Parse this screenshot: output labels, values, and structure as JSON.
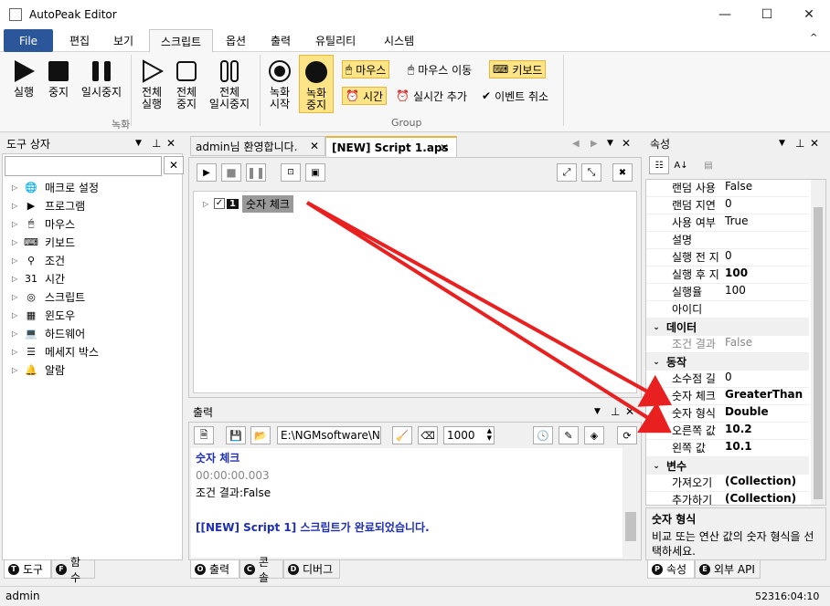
{
  "app": {
    "title": "AutoPeak Editor"
  },
  "window_controls": {
    "minimize": "—",
    "maximize": "☐",
    "close": "✕"
  },
  "menu": {
    "file": "File",
    "edit": "편집",
    "view": "보기",
    "script": "스크립트",
    "options": "옵션",
    "output": "출력",
    "utility": "유틸리티",
    "system": "시스템",
    "collapse": "^"
  },
  "ribbon": {
    "run": "실행",
    "stop": "중지",
    "pause": "일시중지",
    "run_all": [
      "전체",
      "실행"
    ],
    "stop_all": [
      "전체",
      "중지"
    ],
    "pause_all": [
      "전체",
      "일시중지"
    ],
    "rec_start": [
      "녹화",
      "시작"
    ],
    "rec_stop": [
      "녹화",
      "중지"
    ],
    "mouse": "마우스",
    "mouse_move": "마우스 이동",
    "keyboard": "키보드",
    "time": "시간",
    "realtime_add": "실시간 추가",
    "event_cancel": "이벤트 취소",
    "group_record": "녹화",
    "group_group": "Group"
  },
  "toolbox": {
    "title": "도구 상자",
    "clear": "✕",
    "items": [
      "매크로 설정",
      "프로그램",
      "마우스",
      "키보드",
      "조건",
      "시간",
      "스크립트",
      "윈도우",
      "하드웨어",
      "메세지 박스",
      "알람"
    ],
    "tab_tools": "도구",
    "tab_functions": "함수"
  },
  "doc_tabs": {
    "tab1": "admin님 환영합니다.",
    "tab2": "[NEW] Script 1.aps"
  },
  "script_tree": {
    "num": "1",
    "label": "숫자 체크"
  },
  "output": {
    "title": "출력",
    "path": "E:\\NGMsoftware\\NG",
    "count": "1000",
    "lines": [
      {
        "text": "숫자 체크",
        "cls": "blue b"
      },
      {
        "text": "00:00:00.003",
        "cls": "gray"
      },
      {
        "text": "조건 결과:False",
        "cls": ""
      },
      {
        "text": "",
        "cls": ""
      },
      {
        "text": "[[NEW] Script 1] 스크립트가 완료되었습니다.",
        "cls": "blue b"
      }
    ],
    "tab_output": "출력",
    "tab_console": "콘솔",
    "tab_debug": "디버그"
  },
  "properties": {
    "title": "속성",
    "rows": [
      {
        "type": "row",
        "k": "랜덤 사용",
        "v": "False"
      },
      {
        "type": "row",
        "k": "랜덤 지연",
        "v": "0"
      },
      {
        "type": "row",
        "k": "사용 여부",
        "v": "True"
      },
      {
        "type": "row",
        "k": "설명",
        "v": ""
      },
      {
        "type": "row",
        "k": "실행 전 지",
        "v": "0"
      },
      {
        "type": "row",
        "k": "실행 후 지",
        "v": "100",
        "bold": true
      },
      {
        "type": "row",
        "k": "실행율",
        "v": "100"
      },
      {
        "type": "row",
        "k": "아이디",
        "v": ""
      },
      {
        "type": "cat",
        "k": "데이터"
      },
      {
        "type": "row",
        "k": "조건 결과",
        "v": "False",
        "gray": true
      },
      {
        "type": "cat",
        "k": "동작"
      },
      {
        "type": "row",
        "k": "소수점 길",
        "v": "0"
      },
      {
        "type": "row",
        "k": "숫자 체크",
        "v": "GreaterThan",
        "bold": true
      },
      {
        "type": "row",
        "k": "숫자 형식",
        "v": "Double",
        "bold": true
      },
      {
        "type": "row",
        "k": "오른쪽 값",
        "v": "10.2",
        "bold": true
      },
      {
        "type": "row",
        "k": "왼쪽 값",
        "v": "10.1",
        "bold": true
      },
      {
        "type": "cat",
        "k": "변수"
      },
      {
        "type": "row",
        "k": "가져오기",
        "v": "(Collection)",
        "bold": true
      },
      {
        "type": "row",
        "k": "추가하기",
        "v": "(Collection)",
        "bold": true
      }
    ],
    "desc_title": "숫자 형식",
    "desc_text": "비교 또는 연산 값의 숫자 형식을 선택하세요.",
    "tab_props": "속성",
    "tab_external": "외부 API"
  },
  "status": {
    "user": "admin",
    "time": "52316:04:10"
  },
  "colors": {
    "accent": "#2b579a",
    "highlight": "#fde487",
    "arrow": "#e8201f",
    "blue_text": "#1e2eb4"
  }
}
